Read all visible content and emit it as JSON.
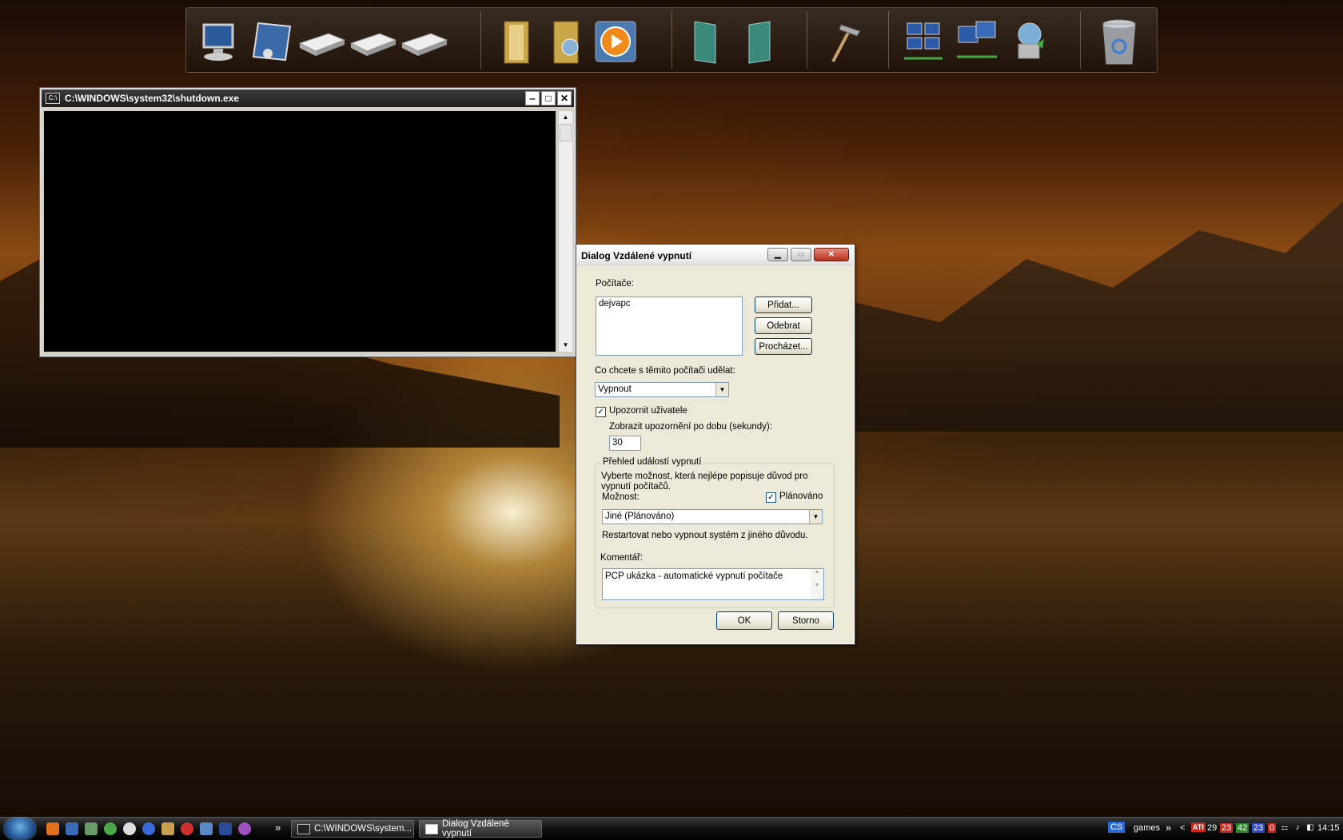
{
  "console": {
    "title": "C:\\WINDOWS\\system32\\shutdown.exe",
    "icon_text": "C:\\"
  },
  "dialog": {
    "title": "Dialog Vzdálené vypnutí",
    "computers_label": "Počítače:",
    "computers_list": [
      "dejvapc"
    ],
    "add_button": "Přidat...",
    "remove_button": "Odebrat",
    "browse_button": "Procházet...",
    "action_label": "Co chcete s těmito počítači udělat:",
    "action_value": "Vypnout",
    "warn_checkbox_label": "Upozornit uživatele",
    "warn_checked": true,
    "warn_time_label": "Zobrazit upozornění po dobu (sekundy):",
    "warn_time_value": "30",
    "events_group": "Přehled událostí vypnutí",
    "events_desc": "Vyberte možnost, která nejlépe popisuje důvod pro vypnutí počítačů.",
    "option_label": "Možnost:",
    "planned_label": "Plánováno",
    "planned_checked": true,
    "option_value": "Jiné (Plánováno)",
    "option_desc": "Restartovat nebo vypnout systém z jiného důvodu.",
    "comment_label": "Komentář:",
    "comment_value": "PCP ukázka - automatické vypnutí počítače",
    "ok_button": "OK",
    "cancel_button": "Storno"
  },
  "dock": {
    "icons": [
      "my-computer-icon",
      "control-panel-icon",
      "drive-icon",
      "drive-icon",
      "drive-icon",
      "documents-folder-icon",
      "music-folder-icon",
      "media-player-icon",
      "book-icon",
      "book-icon",
      "hammer-tool-icon",
      "network-icon",
      "network-computers-icon",
      "network-sync-icon",
      "recycle-bin-icon"
    ]
  },
  "taskbar": {
    "tasks": [
      {
        "label": "C:\\WINDOWS\\system..."
      },
      {
        "label": "Dialog Vzdálené vypnutí"
      }
    ],
    "chevron": "»",
    "language": "CS",
    "toolbar_label": "games",
    "toolbar_chevron": "»",
    "tray_numbers": [
      "29",
      "23",
      "42",
      "23",
      "0"
    ],
    "ati_label": "ATI",
    "clock": "14:15",
    "colors": {
      "red": "#c8281e",
      "green": "#2a8a2a",
      "blue": "#2a4ac8"
    }
  }
}
